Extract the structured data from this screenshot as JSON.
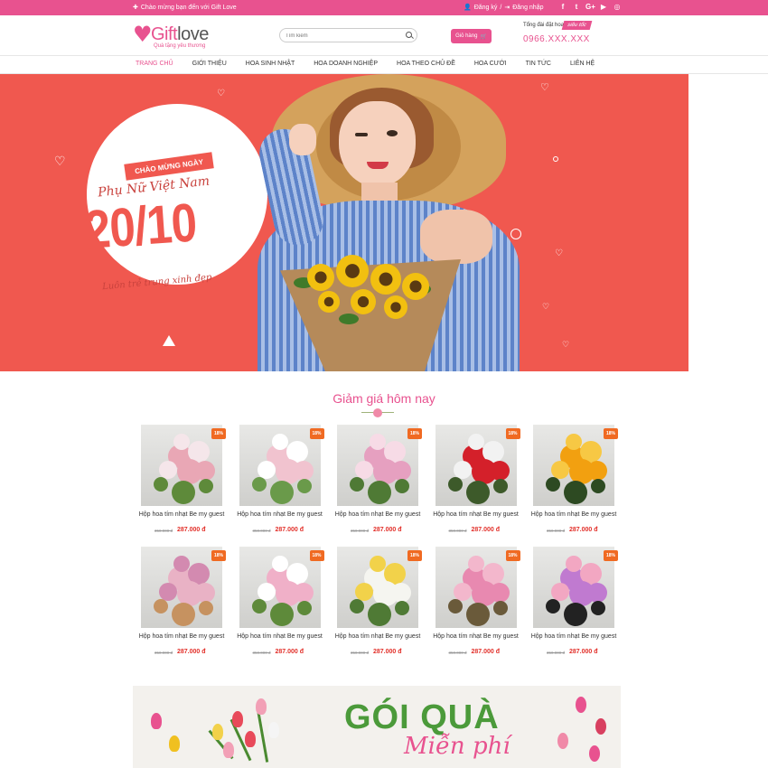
{
  "topbar": {
    "welcome": "Chào mừng bạn đến với Gift Love",
    "register": "Đăng ký",
    "separator": "/",
    "login": "Đăng nhập",
    "social": [
      "f",
      "t",
      "G+",
      "▶",
      "◎"
    ]
  },
  "header": {
    "logo_word_a": "Gift",
    "logo_word_b": "love",
    "logo_tagline": "Quà tặng yêu thương",
    "search_placeholder": "Tìm kiếm",
    "cart_label": "Giỏ hàng",
    "hotline_label": "Tổng đài đặt hoa",
    "hotline_badge": "siêu tốc",
    "hotline_number": "0966.XXX.XXX"
  },
  "nav": {
    "items": [
      "TRANG CHỦ",
      "GIỚI THIỆU",
      "HOA SINH NHẬT",
      "HOA DOANH NGHIỆP",
      "HOA THEO CHỦ ĐỀ",
      "HOA CƯỚI",
      "TIN TỨC",
      "LIÊN HỆ"
    ],
    "active_index": 0
  },
  "banner": {
    "ribbon": "CHÀO MỪNG NGÀY",
    "headline": "Phụ Nữ Việt Nam",
    "date": "20/10",
    "slogan": "Luôn trẻ trung xinh đẹp"
  },
  "section": {
    "title": "Giảm giá hôm nay"
  },
  "products": [
    {
      "name": "Hộp hoa tím nhạt Be my guest",
      "old_price": "350.000 đ",
      "price": "287.000 đ",
      "badge": "18%",
      "colors": [
        "#e9a7b5",
        "#f5e6ea",
        "#5e8a3a"
      ]
    },
    {
      "name": "Hộp hoa tím nhạt Be my guest",
      "old_price": "350.000 đ",
      "price": "287.000 đ",
      "badge": "18%",
      "colors": [
        "#f1c3cf",
        "#ffffff",
        "#6a9a4a"
      ]
    },
    {
      "name": "Hộp hoa tím nhạt Be my guest",
      "old_price": "350.000 đ",
      "price": "287.000 đ",
      "badge": "18%",
      "colors": [
        "#e6a0c0",
        "#f7dbe6",
        "#4f7a35"
      ]
    },
    {
      "name": "Hộp hoa tím nhạt Be my guest",
      "old_price": "350.000 đ",
      "price": "287.000 đ",
      "badge": "18%",
      "colors": [
        "#d4202a",
        "#f2f2f2",
        "#3d5a2a"
      ]
    },
    {
      "name": "Hộp hoa tím nhạt Be my guest",
      "old_price": "350.000 đ",
      "price": "287.000 đ",
      "badge": "18%",
      "colors": [
        "#f2a010",
        "#f7c844",
        "#2d4a22"
      ]
    },
    {
      "name": "Hộp hoa tím nhạt Be my guest",
      "old_price": "350.000 đ",
      "price": "287.000 đ",
      "badge": "18%",
      "colors": [
        "#e9b2c5",
        "#d38ab0",
        "#c69260"
      ]
    },
    {
      "name": "Hộp hoa tím nhạt Be my guest",
      "old_price": "350.000 đ",
      "price": "287.000 đ",
      "badge": "18%",
      "colors": [
        "#f0b0c8",
        "#ffffff",
        "#5e8a3a"
      ]
    },
    {
      "name": "Hộp hoa tím nhạt Be my guest",
      "old_price": "350.000 đ",
      "price": "287.000 đ",
      "badge": "18%",
      "colors": [
        "#f5f5f0",
        "#f2d24a",
        "#4f7a35"
      ]
    },
    {
      "name": "Hộp hoa tím nhạt Be my guest",
      "old_price": "350.000 đ",
      "price": "287.000 đ",
      "badge": "18%",
      "colors": [
        "#e889b0",
        "#f3b7cc",
        "#6a5a3a"
      ]
    },
    {
      "name": "Hộp hoa tím nhạt Be my guest",
      "old_price": "350.000 đ",
      "price": "287.000 đ",
      "badge": "18%",
      "colors": [
        "#c07ad0",
        "#f2a7c2",
        "#222222"
      ]
    }
  ],
  "promo": {
    "title": "GÓI QUÀ",
    "subtitle": "Miễn phí"
  },
  "colors": {
    "brand_pink": "#e8528f",
    "banner_red": "#f0584f",
    "price_red": "#e2302a",
    "badge_orange": "#f06a22"
  }
}
